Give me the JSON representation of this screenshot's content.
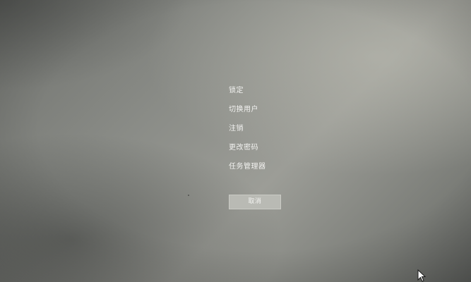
{
  "menu": {
    "items": [
      {
        "label": "锁定"
      },
      {
        "label": "切换用户"
      },
      {
        "label": "注销"
      },
      {
        "label": "更改密码"
      },
      {
        "label": "任务管理器"
      }
    ]
  },
  "cancel_button": {
    "label": "取消"
  },
  "cursor": {
    "icon": "mouse-pointer-icon"
  }
}
